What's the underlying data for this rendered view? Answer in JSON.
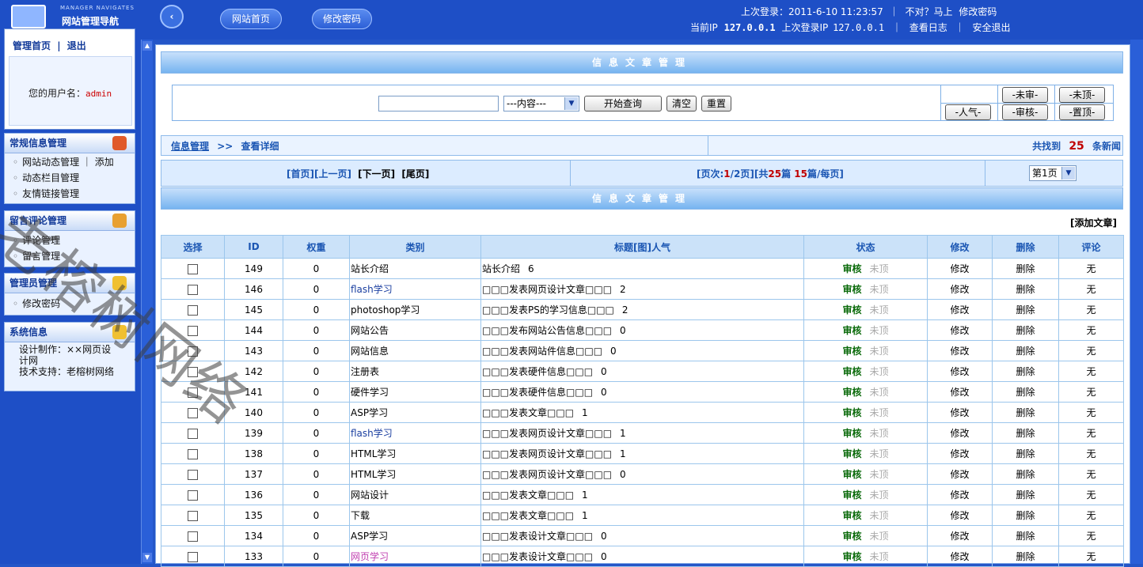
{
  "sidebar": {
    "logo_sub": "MANAGER NAVIGATES",
    "logo_title": "网站管理导航",
    "home_link": "管理首页",
    "separator": "|",
    "logout_link": "退出",
    "username_label": "您的用户名：",
    "username": "admin",
    "sections": [
      {
        "title": "常规信息管理",
        "items": [
          "网站动态管理 ｜ 添加",
          "动态栏目管理",
          "友情链接管理"
        ]
      },
      {
        "title": "留言评论管理",
        "items": [
          "评论管理",
          "留言管理"
        ]
      },
      {
        "title": "管理员管理",
        "items": [
          "修改密码"
        ]
      },
      {
        "title": "系统信息",
        "items": [
          "设计制作：××网页设计网",
          "技术支持：老榕树网络"
        ]
      }
    ]
  },
  "header": {
    "back_icon": "‹",
    "home_btn": "网站首页",
    "pwd_btn": "修改密码",
    "last_login_label": "上次登录：2011-6-10 11:23:57",
    "wrong_label": "不对？马上",
    "change_pwd_link": "修改密码",
    "current_ip_label": "当前IP",
    "current_ip": "127.0.0.1",
    "last_ip_label": "上次登录IP",
    "last_ip": "127.0.0.1",
    "view_log": "查看日志",
    "safe_exit": "安全退出"
  },
  "main": {
    "title": "信息文章管理",
    "search": {
      "input_value": "",
      "select_value": "---内容---",
      "search_btn": "开始查询",
      "clear_btn": "清空",
      "reset_btn": "重置",
      "filter_unreviewed": "-未审-",
      "filter_notop": "-未顶-",
      "filter_popular": "-人气-",
      "filter_reviewed": "-审核-",
      "filter_top": "-置顶-"
    },
    "breadcrumb": {
      "root": "信息管理",
      "sep": ">>",
      "current": "查看详细"
    },
    "found": {
      "prefix": "共找到",
      "count": "25",
      "suffix": "条新闻"
    },
    "pager": {
      "first": "[首页]",
      "prev": "[上一页]",
      "next": "[下一页]",
      "last": "[尾页]",
      "info_prefix": "[页次:",
      "page_current": "1",
      "page_sep": "/",
      "page_total": "2",
      "info_mid": "页][共",
      "total": "25",
      "info_mid2": "篇 ",
      "per_page": "15",
      "info_suffix": "篇/每页]",
      "page_select": "第1页"
    },
    "list_title": "信息文章管理",
    "add_link": "[添加文章]",
    "columns": [
      "选择",
      "ID",
      "权重",
      "类别",
      "标题[图]人气",
      "状态",
      "修改",
      "删除",
      "评论"
    ],
    "rows": [
      {
        "id": "149",
        "weight": "0",
        "cat": "站长介绍",
        "cat_style": "",
        "title": "站长介绍",
        "hits": "6"
      },
      {
        "id": "146",
        "weight": "0",
        "cat": "flash学习",
        "cat_style": "cat-flash",
        "title": "□□□发表网页设计文章□□□",
        "hits": "2"
      },
      {
        "id": "145",
        "weight": "0",
        "cat": "photoshop学习",
        "cat_style": "",
        "title": "□□□发表PS的学习信息□□□",
        "hits": "2"
      },
      {
        "id": "144",
        "weight": "0",
        "cat": "网站公告",
        "cat_style": "",
        "title": "□□□发布网站公告信息□□□",
        "hits": "0"
      },
      {
        "id": "143",
        "weight": "0",
        "cat": "网站信息",
        "cat_style": "",
        "title": "□□□发表网站件信息□□□",
        "hits": "0"
      },
      {
        "id": "142",
        "weight": "0",
        "cat": "注册表",
        "cat_style": "",
        "title": "□□□发表硬件信息□□□",
        "hits": "0"
      },
      {
        "id": "141",
        "weight": "0",
        "cat": "硬件学习",
        "cat_style": "",
        "title": "□□□发表硬件信息□□□",
        "hits": "0"
      },
      {
        "id": "140",
        "weight": "0",
        "cat": "ASP学习",
        "cat_style": "",
        "title": "□□□发表文章□□□",
        "hits": "1"
      },
      {
        "id": "139",
        "weight": "0",
        "cat": "flash学习",
        "cat_style": "cat-flash",
        "title": "□□□发表网页设计文章□□□",
        "hits": "1"
      },
      {
        "id": "138",
        "weight": "0",
        "cat": "HTML学习",
        "cat_style": "",
        "title": "□□□发表网页设计文章□□□",
        "hits": "1"
      },
      {
        "id": "137",
        "weight": "0",
        "cat": "HTML学习",
        "cat_style": "",
        "title": "□□□发表网页设计文章□□□",
        "hits": "0"
      },
      {
        "id": "136",
        "weight": "0",
        "cat": "网站设计",
        "cat_style": "",
        "title": "□□□发表文章□□□",
        "hits": "1"
      },
      {
        "id": "135",
        "weight": "0",
        "cat": "下载",
        "cat_style": "",
        "title": "□□□发表文章□□□",
        "hits": "1"
      },
      {
        "id": "134",
        "weight": "0",
        "cat": "ASP学习",
        "cat_style": "",
        "title": "□□□发表设计文章□□□",
        "hits": "0"
      },
      {
        "id": "133",
        "weight": "0",
        "cat": "网页学习",
        "cat_style": "cat-pink",
        "title": "□□□发表设计文章□□□",
        "hits": "0"
      }
    ],
    "status_ok": "审核",
    "status_notop": "未顶",
    "edit_label": "修改",
    "delete_label": "删除",
    "comment_label": "无"
  },
  "watermark": "老榕树网络",
  "colors": {
    "primary_blue": "#1e4fc6",
    "header_bar": "#76b4f0",
    "status_green": "#0a6a0a",
    "count_red": "#c00000"
  }
}
